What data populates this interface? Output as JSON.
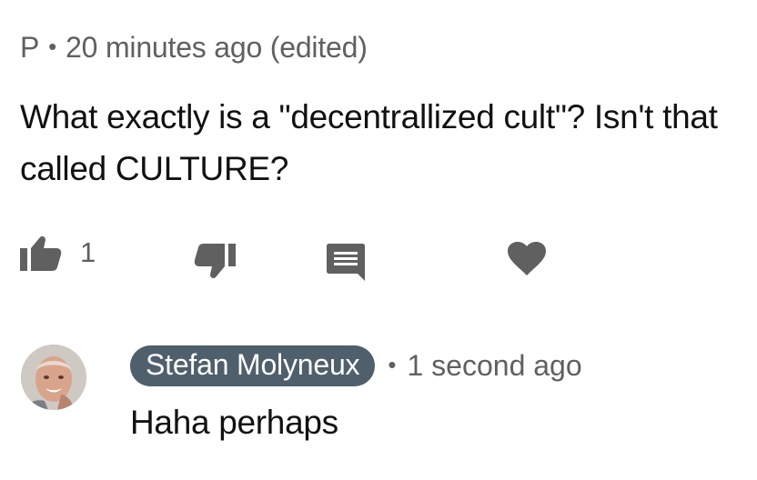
{
  "comment": {
    "author": "P",
    "timestamp": "20 minutes ago",
    "edited_label": "(edited)",
    "text": "What exactly is a \"decentrallized cult\"? Isn't that called CULTURE?",
    "likes": "1",
    "icons": {
      "like": "thumbs-up-icon",
      "dislike": "thumbs-down-icon",
      "reply": "reply-comment-icon",
      "heart": "heart-icon"
    }
  },
  "reply": {
    "author": "Stefan Molyneux",
    "timestamp": "1 second ago",
    "text": "Haha perhaps"
  },
  "colors": {
    "icon": "#606060",
    "author_chip": "#4f5f6b",
    "meta_text": "#606060"
  }
}
